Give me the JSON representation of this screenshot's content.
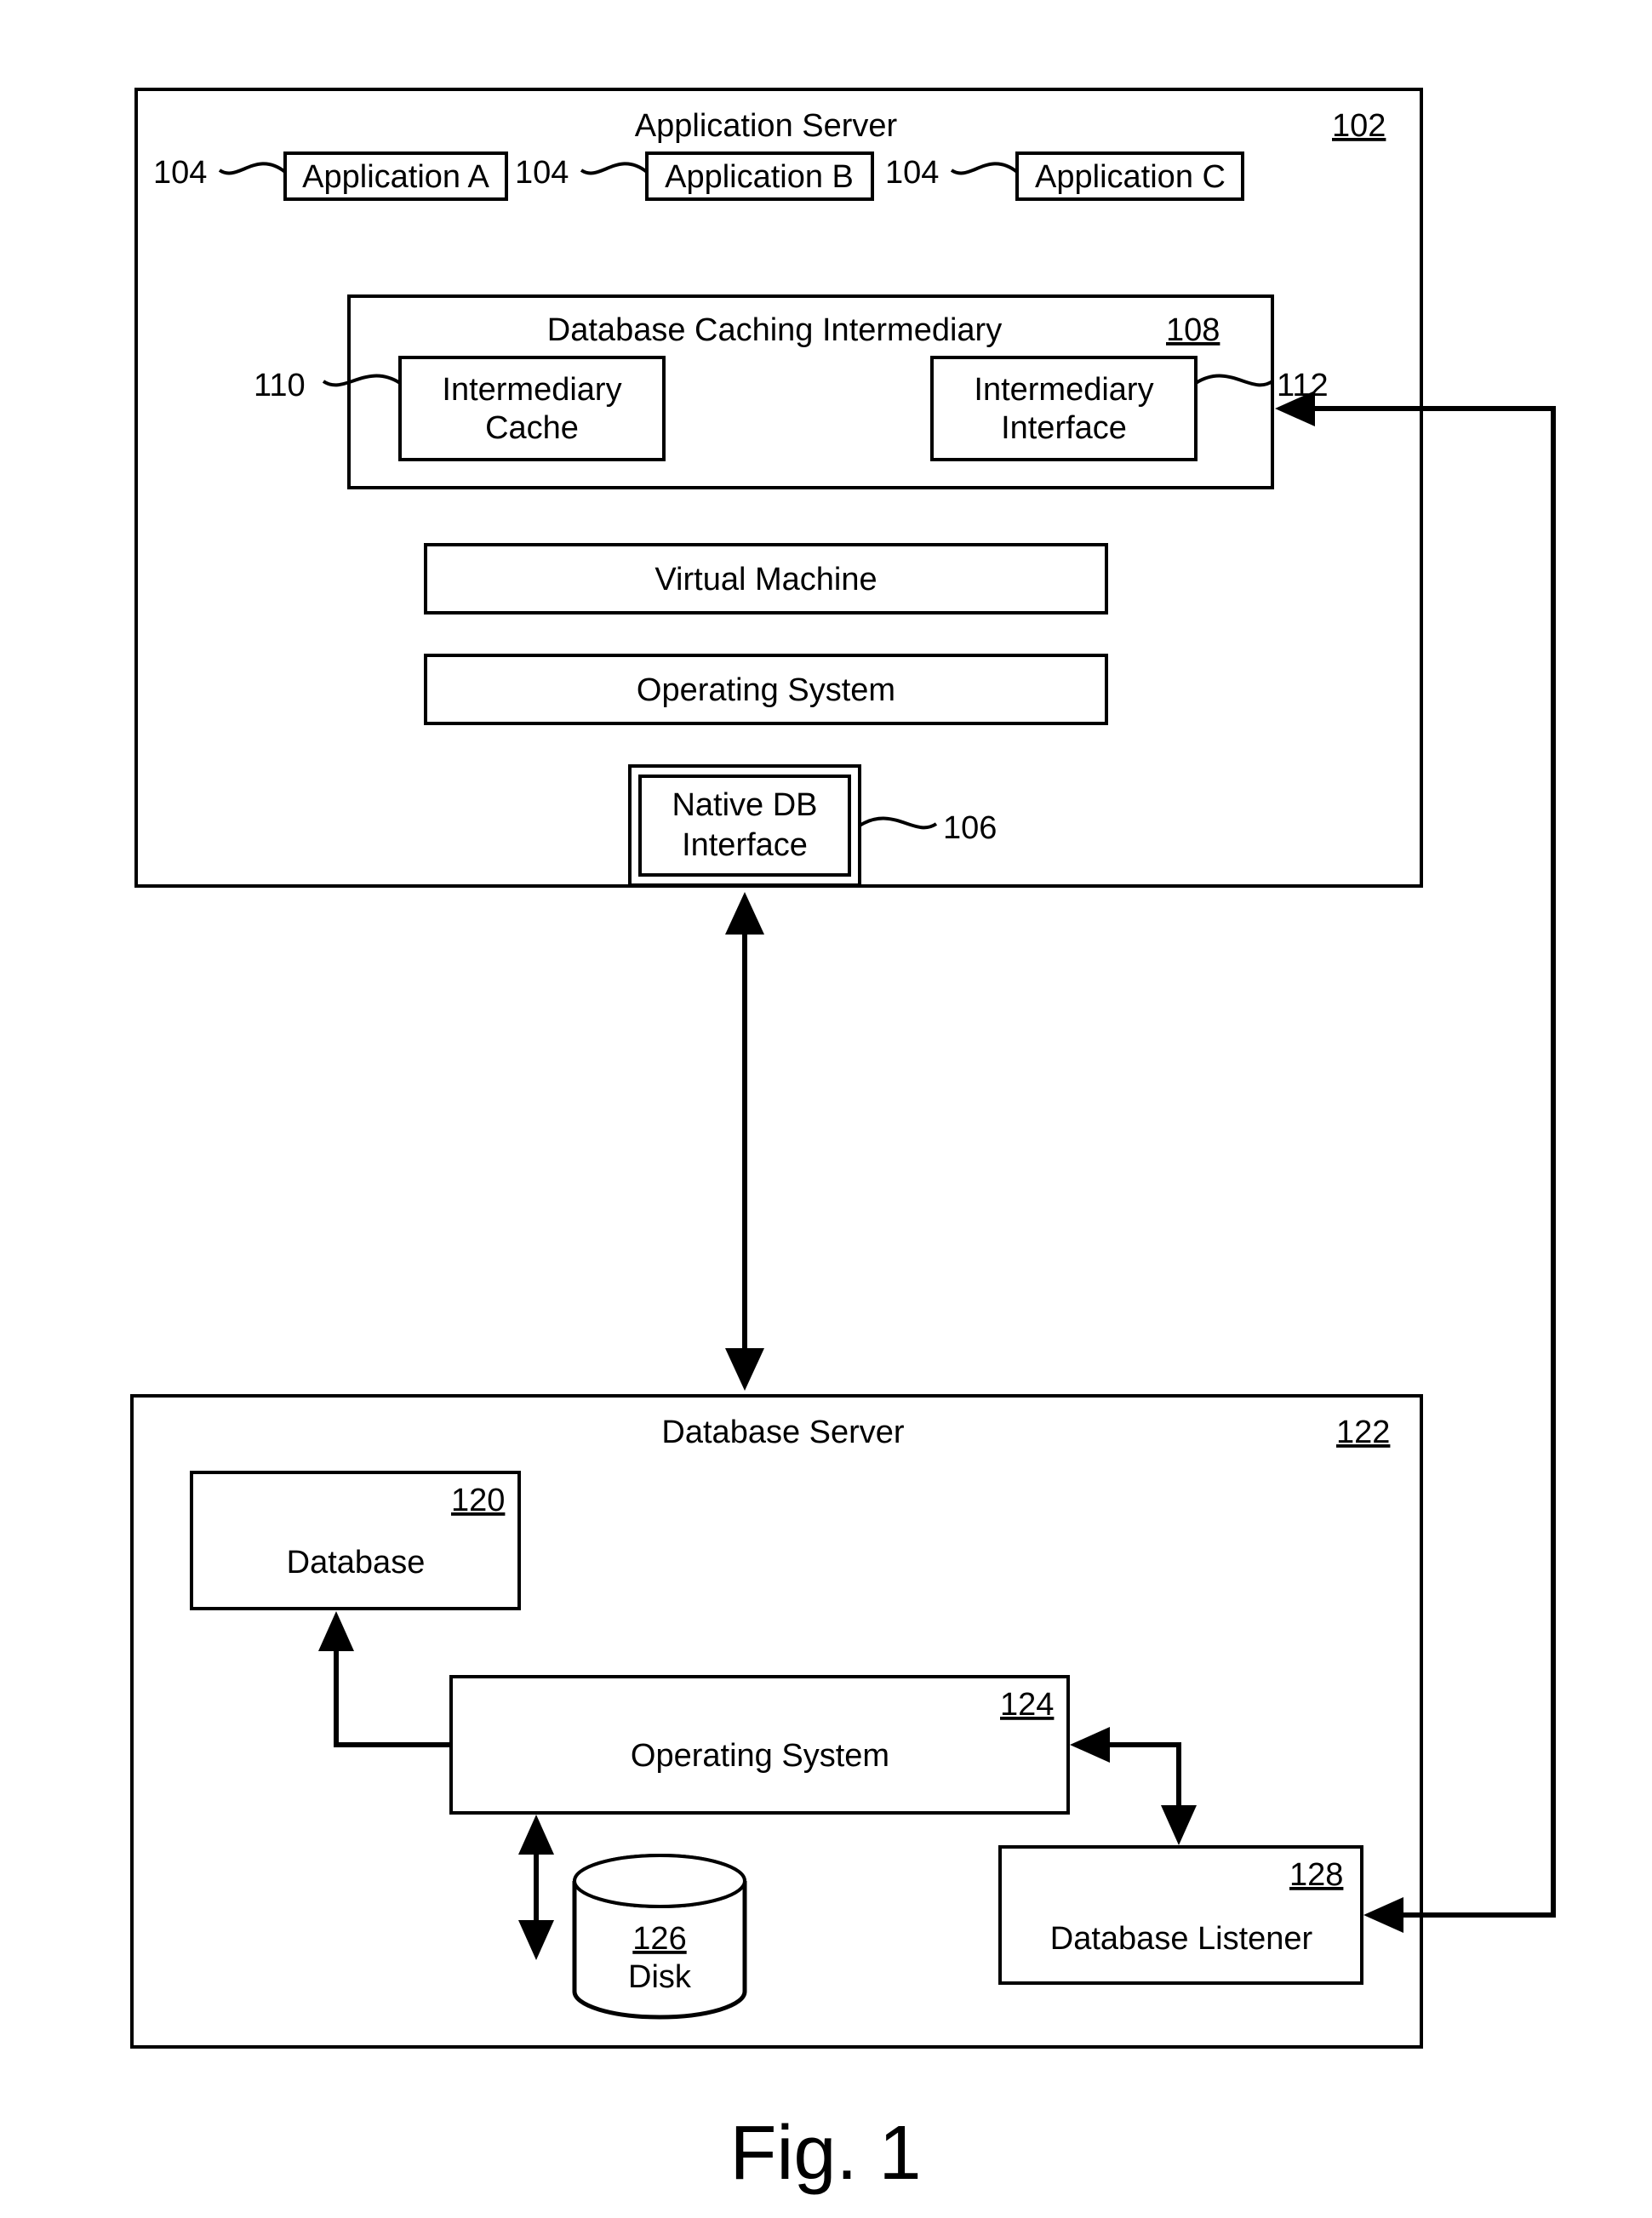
{
  "figure_label": "Fig. 1",
  "app_server": {
    "title": "Application Server",
    "ref": "102",
    "apps": [
      {
        "label": "Application A",
        "ref": "104"
      },
      {
        "label": "Application B",
        "ref": "104"
      },
      {
        "label": "Application C",
        "ref": "104"
      }
    ],
    "dci": {
      "title": "Database Caching Intermediary",
      "ref": "108",
      "cache": {
        "label_l1": "Intermediary",
        "label_l2": "Cache",
        "ref": "110"
      },
      "interface": {
        "label_l1": "Intermediary",
        "label_l2": "Interface",
        "ref": "112"
      }
    },
    "vm": {
      "label": "Virtual Machine"
    },
    "os": {
      "label": "Operating System"
    },
    "native": {
      "label_l1": "Native DB",
      "label_l2": "Interface",
      "ref": "106"
    }
  },
  "db_server": {
    "title": "Database Server",
    "ref": "122",
    "database": {
      "label": "Database",
      "ref": "120"
    },
    "os": {
      "label": "Operating System",
      "ref": "124"
    },
    "disk": {
      "label": "Disk",
      "ref": "126"
    },
    "listener": {
      "label": "Database Listener",
      "ref": "128"
    }
  }
}
